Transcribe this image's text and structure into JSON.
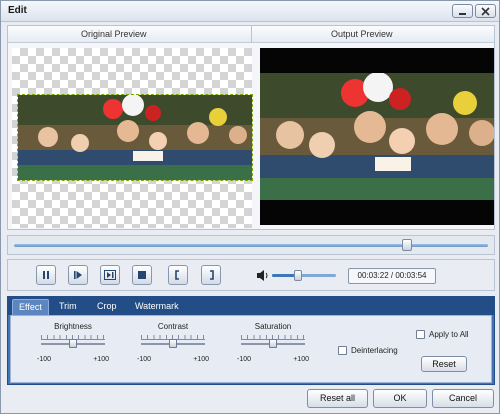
{
  "window": {
    "title": "Edit"
  },
  "icons": {
    "minimize": "minimize-icon",
    "close": "close-icon"
  },
  "preview": {
    "original_label": "Original Preview",
    "output_label": "Output Preview"
  },
  "seek": {
    "progress": 0.83
  },
  "player": {
    "buttons": [
      "pause",
      "play-from-start",
      "frame-step",
      "stop",
      "mark-in",
      "mark-out"
    ],
    "volume": 0.4,
    "time": "00:03:22 / 00:03:54"
  },
  "tabs": [
    "Effect",
    "Trim",
    "Crop",
    "Watermark"
  ],
  "active_tab": "Effect",
  "effect": {
    "brightness": {
      "label": "Brightness",
      "min": "-100",
      "max": "+100",
      "value": 0
    },
    "contrast": {
      "label": "Contrast",
      "min": "-100",
      "max": "+100",
      "value": 0
    },
    "saturation": {
      "label": "Saturation",
      "min": "-100",
      "max": "+100",
      "value": 0
    },
    "deinterlacing_label": "Deinterlacing",
    "apply_to_all_label": "Apply to All",
    "reset_label": "Reset"
  },
  "footer": {
    "reset_all": "Reset all",
    "ok": "OK",
    "cancel": "Cancel"
  },
  "colors": {
    "tab_bar": "#234d86",
    "panel_bg": "#e7ecf4",
    "accent": "#4473b1"
  }
}
